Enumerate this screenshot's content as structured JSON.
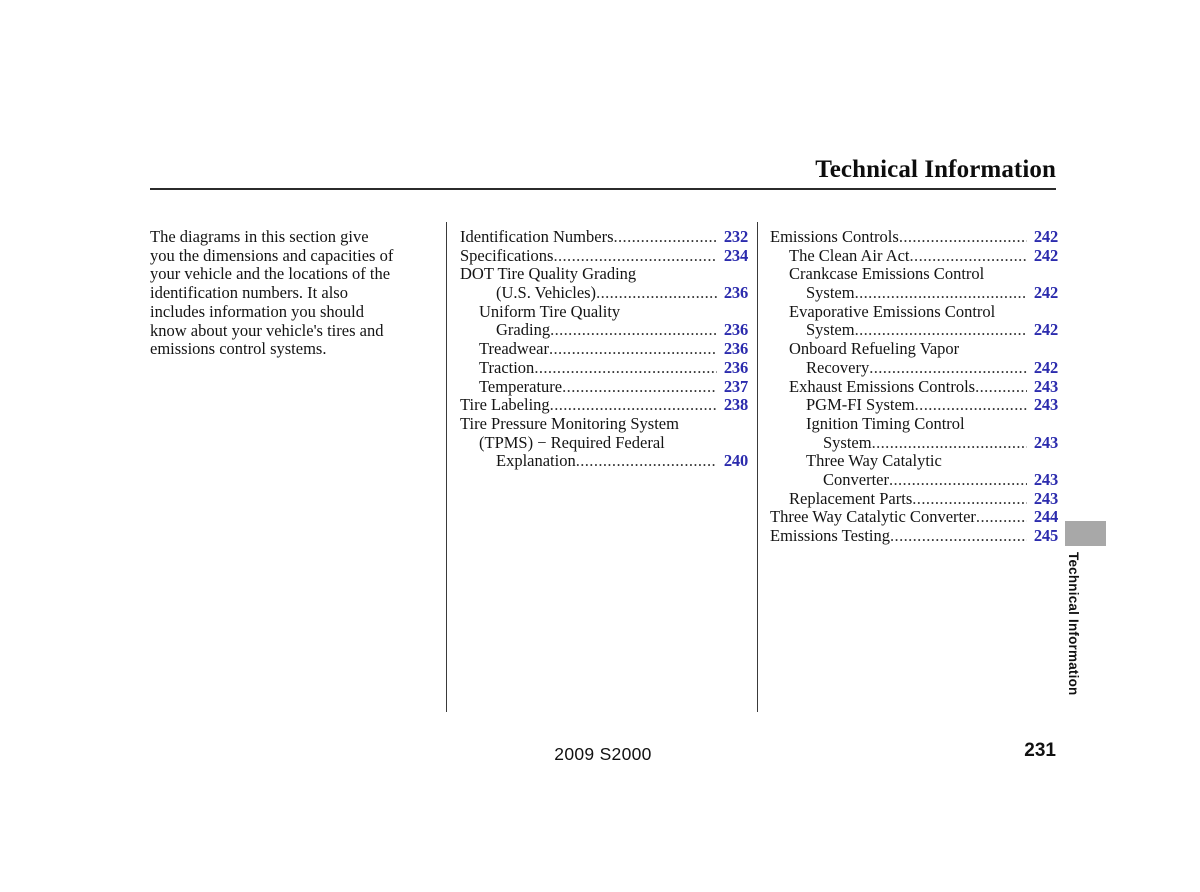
{
  "header": {
    "title": "Technical Information"
  },
  "intro": {
    "lines": [
      "The diagrams in this section give",
      "you the dimensions and capacities of",
      "your vehicle and the locations of the",
      "identification numbers. It also",
      "includes information you should",
      "know about your vehicle's tires and",
      "emissions control systems."
    ]
  },
  "toc_middle": [
    {
      "label": "Identification Numbers",
      "page": "232",
      "indent": 0,
      "leader": true
    },
    {
      "label": "Specifications ",
      "page": "234",
      "indent": 0,
      "leader": true
    },
    {
      "label": "DOT Tire Quality Grading",
      "page": "",
      "indent": 0,
      "leader": false
    },
    {
      "label": "(U.S. Vehicles) ",
      "page": "236",
      "indent": 2,
      "leader": true
    },
    {
      "label": "Uniform Tire Quality",
      "page": "",
      "indent": 1,
      "leader": false
    },
    {
      "label": "Grading ",
      "page": "236",
      "indent": 2,
      "leader": true
    },
    {
      "label": "Treadwear ",
      "page": "236",
      "indent": 1,
      "leader": true
    },
    {
      "label": "Traction",
      "page": "236",
      "indent": 1,
      "leader": true
    },
    {
      "label": "Temperature ",
      "page": "237",
      "indent": 1,
      "leader": true
    },
    {
      "label": "Tire Labeling",
      "page": "238",
      "indent": 0,
      "leader": true
    },
    {
      "label": "Tire Pressure Monitoring System",
      "page": "",
      "indent": 0,
      "leader": false
    },
    {
      "label": "(TPMS) − Required Federal",
      "page": "",
      "indent": 1,
      "leader": false
    },
    {
      "label": "Explanation",
      "page": "240",
      "indent": 2,
      "leader": true
    }
  ],
  "toc_right": [
    {
      "label": "Emissions Controls",
      "page": "242",
      "indent": 0,
      "leader": true
    },
    {
      "label": "The Clean Air Act",
      "page": "242",
      "indent": 1,
      "leader": true
    },
    {
      "label": "Crankcase Emissions Control",
      "page": "",
      "indent": 1,
      "leader": false
    },
    {
      "label": "System",
      "page": "242",
      "indent": 2,
      "leader": true
    },
    {
      "label": "Evaporative Emissions Control",
      "page": "",
      "indent": 1,
      "leader": false
    },
    {
      "label": "System",
      "page": "242",
      "indent": 2,
      "leader": true
    },
    {
      "label": "Onboard Refueling Vapor",
      "page": "",
      "indent": 1,
      "leader": false
    },
    {
      "label": "Recovery ",
      "page": "242",
      "indent": 2,
      "leader": true
    },
    {
      "label": "Exhaust Emissions Controls ",
      "page": "243",
      "indent": 1,
      "leader": true
    },
    {
      "label": "PGM-FI System ",
      "page": "243",
      "indent": 2,
      "leader": true
    },
    {
      "label": "Ignition Timing Control",
      "page": "",
      "indent": 2,
      "leader": false
    },
    {
      "label": "System",
      "page": "243",
      "indent": 3,
      "leader": true
    },
    {
      "label": "Three Way Catalytic",
      "page": "",
      "indent": 2,
      "leader": false
    },
    {
      "label": "Converter",
      "page": "243",
      "indent": 3,
      "leader": true
    },
    {
      "label": "Replacement Parts",
      "page": "243",
      "indent": 1,
      "leader": true
    },
    {
      "label": "Three Way Catalytic Converter",
      "page": "244",
      "indent": 0,
      "leader": true
    },
    {
      "label": "Emissions Testing ",
      "page": "245",
      "indent": 0,
      "leader": true
    }
  ],
  "footer": {
    "model": "2009  S2000",
    "page_number": "231"
  },
  "side_tab": {
    "label": "Technical Information"
  },
  "colors": {
    "page_number_blue": "#2b2bad",
    "tab_gray": "#a8a8a8",
    "text": "#141414"
  }
}
